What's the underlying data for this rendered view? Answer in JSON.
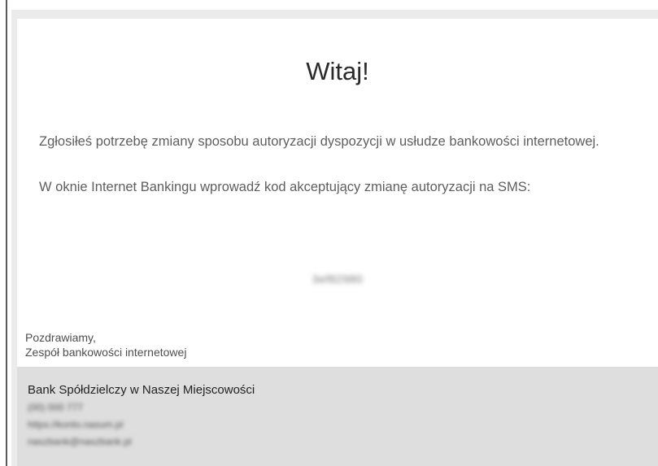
{
  "email": {
    "greeting": "Witaj!",
    "paragraph_1": "Zgłosiłeś potrzebę zmiany sposobu autoryzacji dyspozycji w usłudze bankowości internetowej.",
    "paragraph_2": "W oknie Internet Bankingu wprowadź kod akceptujący zmianę autoryzacji na SMS:",
    "auth_code_blurred": "3ef82980",
    "signoff_line_1": "Pozdrawiamy,",
    "signoff_line_2": "Zespół bankowości internetowej"
  },
  "footer": {
    "bank_name": "Bank Spółdzielczy w Naszej Miejscowości",
    "phone_blurred": "(00) 000 777",
    "url_blurred": "https://konto.nasum.pl",
    "email_blurred": "naszbank@naszbank.pl"
  }
}
